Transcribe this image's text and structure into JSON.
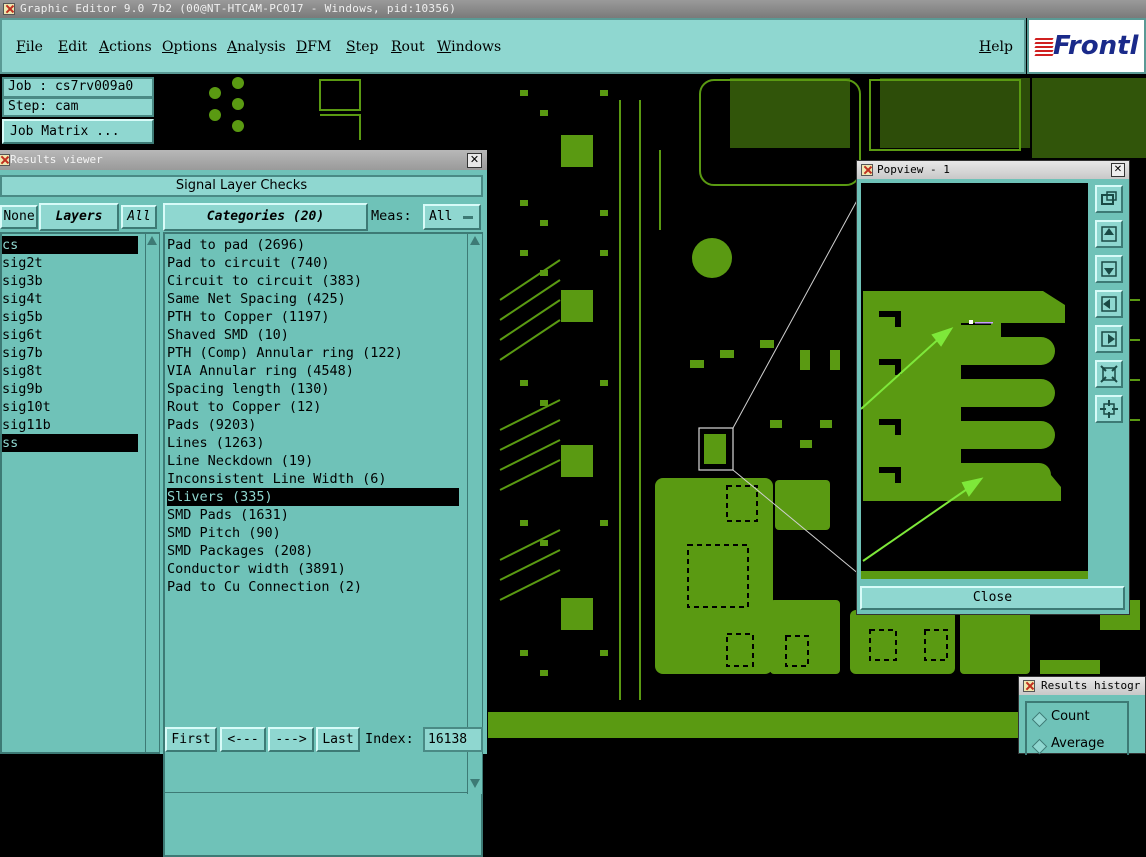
{
  "window": {
    "title": "Graphic Editor 9.0 7b2 (00@NT-HTCAM-PC017 - Windows, pid:10356)"
  },
  "menubar": {
    "items": [
      {
        "label": "File"
      },
      {
        "label": "Edit"
      },
      {
        "label": "Actions"
      },
      {
        "label": "Options"
      },
      {
        "label": "Analysis"
      },
      {
        "label": "DFM"
      },
      {
        "label": "Step"
      },
      {
        "label": "Rout"
      },
      {
        "label": "Windows"
      }
    ],
    "help": "Help",
    "logo": "Frontl"
  },
  "job_panel": {
    "job": "Job : cs7rv009a0",
    "step": "Step: cam",
    "matrix_button": "Job Matrix ..."
  },
  "results_viewer": {
    "title": "Results viewer",
    "header": "Signal Layer Checks",
    "none_button": "None",
    "layers_label": "Layers",
    "all_button": "All",
    "categories_label": "Categories (20)",
    "meas_label": "Meas:",
    "meas_value": "All",
    "layers": [
      {
        "name": "cs",
        "selected": true
      },
      {
        "name": "sig2t",
        "selected": false
      },
      {
        "name": "sig3b",
        "selected": false
      },
      {
        "name": "sig4t",
        "selected": false
      },
      {
        "name": "sig5b",
        "selected": false
      },
      {
        "name": "sig6t",
        "selected": false
      },
      {
        "name": "sig7b",
        "selected": false
      },
      {
        "name": "sig8t",
        "selected": false
      },
      {
        "name": "sig9b",
        "selected": false
      },
      {
        "name": "sig10t",
        "selected": false
      },
      {
        "name": "sig11b",
        "selected": false
      },
      {
        "name": "ss",
        "selected": true
      }
    ],
    "categories": [
      {
        "label": "Pad to pad (2696)",
        "selected": false
      },
      {
        "label": "Pad to circuit (740)",
        "selected": false
      },
      {
        "label": "Circuit to circuit (383)",
        "selected": false
      },
      {
        "label": "Same Net Spacing (425)",
        "selected": false
      },
      {
        "label": "PTH to Copper (1197)",
        "selected": false
      },
      {
        "label": "Shaved SMD (10)",
        "selected": false
      },
      {
        "label": "PTH (Comp) Annular ring (122)",
        "selected": false
      },
      {
        "label": "VIA Annular ring (4548)",
        "selected": false
      },
      {
        "label": "Spacing length (130)",
        "selected": false
      },
      {
        "label": "Rout to Copper (12)",
        "selected": false
      },
      {
        "label": "Pads (9203)",
        "selected": false
      },
      {
        "label": "Lines (1263)",
        "selected": false
      },
      {
        "label": "Line Neckdown (19)",
        "selected": false
      },
      {
        "label": "Inconsistent Line Width (6)",
        "selected": false
      },
      {
        "label": "Slivers (335)",
        "selected": true
      },
      {
        "label": "SMD Pads (1631)",
        "selected": false
      },
      {
        "label": "SMD Pitch (90)",
        "selected": false
      },
      {
        "label": "SMD Packages (208)",
        "selected": false
      },
      {
        "label": "Conductor width (3891)",
        "selected": false
      },
      {
        "label": "Pad to Cu Connection (2)",
        "selected": false
      }
    ],
    "nav": {
      "first": "First",
      "prev": "<---",
      "next": "--->",
      "last": "Last",
      "index_label": "Index:",
      "index_value": "16138"
    }
  },
  "popview": {
    "title": "Popview - 1",
    "close_button": "Close",
    "tools": [
      "zoom-window-icon",
      "pan-up-icon",
      "pan-down-icon",
      "pan-left-icon",
      "pan-right-icon",
      "zoom-fit-icon",
      "zoom-home-icon"
    ]
  },
  "histogram": {
    "title": "Results histogr",
    "options": [
      "Count",
      "Average"
    ]
  },
  "colors": {
    "panel": "#8fd7d0",
    "panel_dark": "#6fc2b8",
    "copper": "#5a9a12",
    "canvas": "#000000",
    "arrow": "#7ee83a"
  }
}
